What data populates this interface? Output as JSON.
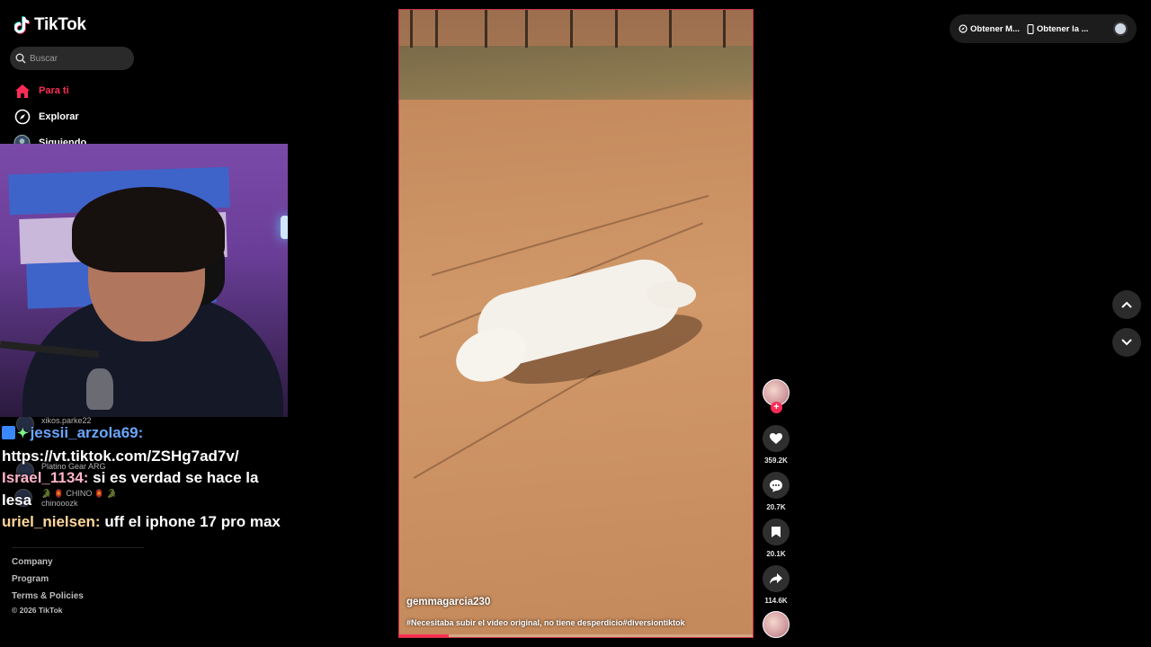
{
  "sidebar": {
    "logo_text": "TikTok",
    "search_placeholder": "Buscar",
    "nav": [
      {
        "label": "Para ti",
        "icon": "home-icon",
        "active": true
      },
      {
        "label": "Explorar",
        "icon": "compass-icon",
        "active": false
      },
      {
        "label": "Siguiendo",
        "icon": "following-avatar-icon",
        "active": false
      }
    ],
    "footer_links": [
      "Company",
      "Program",
      "Terms & Policies"
    ],
    "copyright": "© 2026 TikTok"
  },
  "background_users": [
    {
      "name": "xikos.parke22"
    },
    {
      "name": "Platino Gear ARG"
    },
    {
      "name": "🐊 🏮 CHINO 🏮 🐊"
    },
    {
      "name": "chinooozk"
    }
  ],
  "chat": [
    {
      "user": "jessii_arzola69:",
      "message": "",
      "color": "#6aa6ff",
      "badges": true
    },
    {
      "user": "",
      "message": "https://vt.tiktok.com/ZSHg7ad7v/",
      "color": "#ffffff"
    },
    {
      "user": "Israel_1134:",
      "message": " si es verdad se hace la lesa",
      "color": "#ffb4c8"
    },
    {
      "user": "uriel_nielsen:",
      "message": " uff el iphone 17 pro max",
      "color": "#ffd79a"
    }
  ],
  "video": {
    "author": "gemmagarcia230",
    "caption": "#Necesitaba subir el video original, no tiene desperdicio#diversiontiktok",
    "progress": 0.14
  },
  "actions": {
    "likes": "359.2K",
    "comments": "20.7K",
    "saves": "20.1K",
    "shares": "114.6K",
    "follow_symbol": "+"
  },
  "topbar": {
    "item1": "Obtener M...",
    "item2": "Obtener la ..."
  },
  "colors": {
    "accent": "#fe2c55",
    "background": "#000000"
  }
}
